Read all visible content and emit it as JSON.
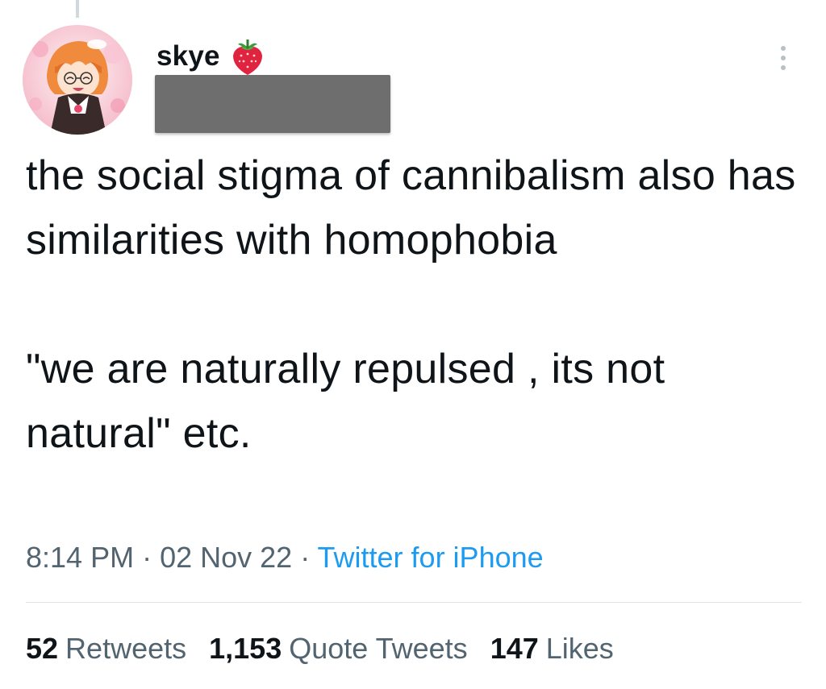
{
  "tweet": {
    "author": {
      "display_name": "skye",
      "name_emoji": "strawberry-icon",
      "handle_redacted": true
    },
    "text": "the social stigma of cannibalism also has similarities with homophobia\n\n\"we are naturally repulsed , its not natural\" etc.",
    "time": "8:14 PM",
    "date": "02 Nov 22",
    "separator": " · ",
    "source": "Twitter for iPhone",
    "stats": {
      "retweets": {
        "count": "52",
        "label": "Retweets"
      },
      "quote_tweets": {
        "count": "1,153",
        "label": "Quote Tweets"
      },
      "likes": {
        "count": "147",
        "label": "Likes"
      }
    }
  },
  "colors": {
    "text_primary": "#0f1419",
    "text_secondary": "#536471",
    "link": "#1d9bf0",
    "redaction": "#6e6e6e"
  },
  "icons": [
    "more-icon",
    "strawberry-icon"
  ]
}
